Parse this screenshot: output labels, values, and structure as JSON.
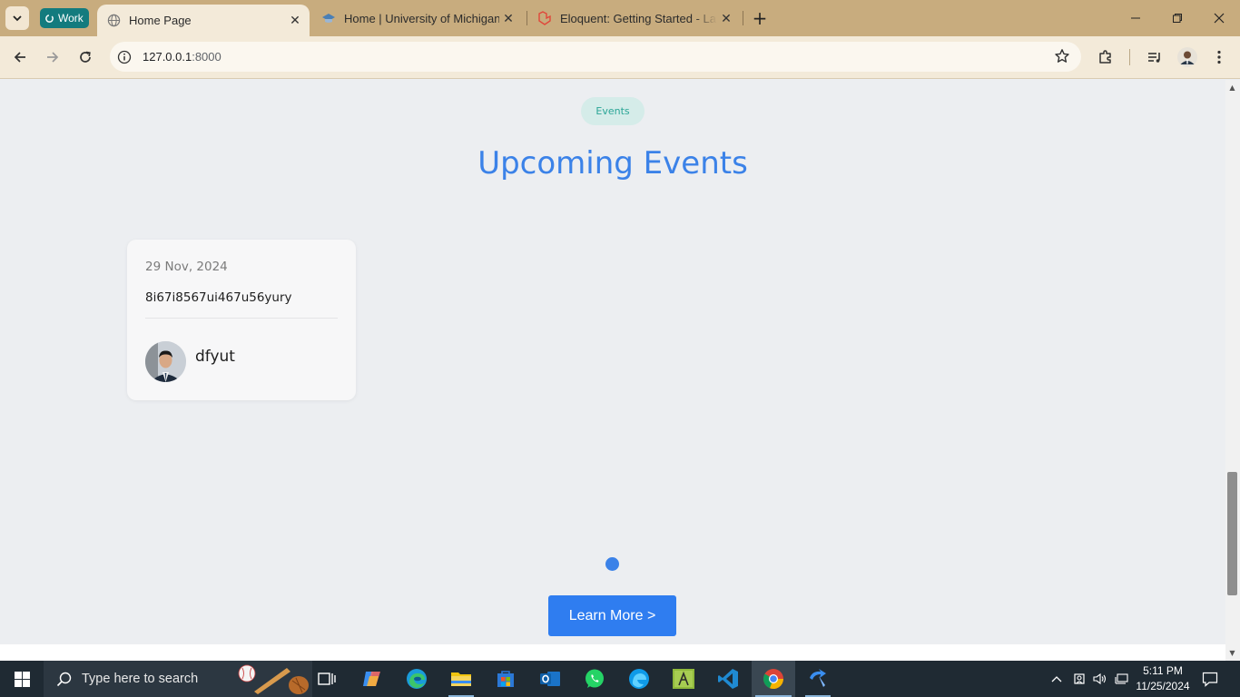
{
  "browser": {
    "profile_label": "Work",
    "tabs": [
      {
        "title": "Home Page",
        "active": true
      },
      {
        "title": "Home | University of Michigan",
        "active": false
      },
      {
        "title": "Eloquent: Getting Started - Lara",
        "active": false
      }
    ],
    "url_host": "127.0.0.1",
    "url_port": ":8000"
  },
  "page": {
    "section_pill": "Events",
    "section_title": "Upcoming Events",
    "events": [
      {
        "date": "29 Nov, 2024",
        "title": "8i67i8567ui467u56yury",
        "author": "dfyut"
      }
    ],
    "learn_more_label": "Learn More >"
  },
  "taskbar": {
    "search_placeholder": "Type here to search",
    "time": "5:11 PM",
    "date": "11/25/2024",
    "apps": [
      "task-view",
      "copilot",
      "edge",
      "file-explorer",
      "microsoft-store",
      "outlook",
      "whatsapp",
      "edge-beta",
      "idle",
      "vscode",
      "chrome",
      "remote-app"
    ]
  },
  "colors": {
    "accent": "#3b82e8",
    "pill_text": "#2aa596",
    "tab_strip": "#c8ac7e",
    "taskbar": "#1f2a33"
  }
}
